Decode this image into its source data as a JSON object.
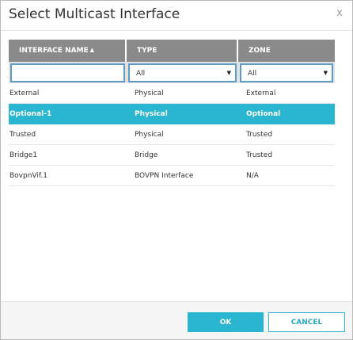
{
  "dialog": {
    "title": "Select Multicast Interface",
    "close_glyph": "x"
  },
  "table": {
    "headers": [
      {
        "label": "INTERFACE NAME",
        "sort_icon": "sort-ascending-icon",
        "sort_glyph": "▲"
      },
      {
        "label": "TYPE"
      },
      {
        "label": "ZONE"
      }
    ],
    "filters": {
      "name_value": "",
      "type_selected": "All",
      "zone_selected": "All",
      "dropdown_glyph": "▼"
    },
    "rows": [
      {
        "name": "External",
        "type": "Physical",
        "zone": "External",
        "selected": false
      },
      {
        "name": "Optional-1",
        "type": "Physical",
        "zone": "Optional",
        "selected": true
      },
      {
        "name": "Trusted",
        "type": "Physical",
        "zone": "Trusted",
        "selected": false
      },
      {
        "name": "Bridge1",
        "type": "Bridge",
        "zone": "Trusted",
        "selected": false
      },
      {
        "name": "BovpnVif.1",
        "type": "BOVPN Interface",
        "zone": "N/A",
        "selected": false
      }
    ]
  },
  "footer": {
    "ok_label": "OK",
    "cancel_label": "CANCEL"
  },
  "colors": {
    "accent": "#2ab5d0",
    "header_bg": "#8a8a8a",
    "filter_border": "#5f9cc5"
  }
}
